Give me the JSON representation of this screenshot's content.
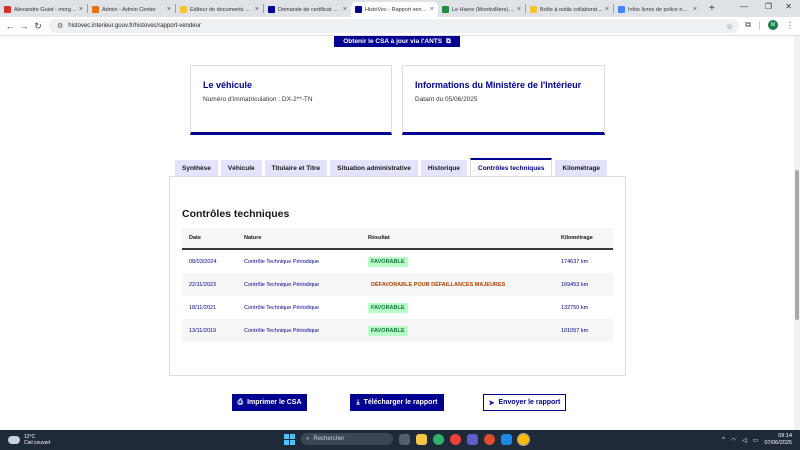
{
  "browser": {
    "tabs": [
      {
        "title": "Alexandre Guiot - morgu...",
        "favicon_color": "#d93025",
        "active": false
      },
      {
        "title": "Admin - Admin Center",
        "favicon_color": "#e8710a",
        "active": false
      },
      {
        "title": "Éditeur de documents de...",
        "favicon_color": "#f4c430",
        "active": false
      },
      {
        "title": "Demande de certificat de...",
        "favicon_color": "#000091",
        "active": false
      },
      {
        "title": "HistoVec - Rapport vendeur",
        "favicon_color": "#000091",
        "active": true
      },
      {
        "title": "Le Havre (Montivilliers) - ...",
        "favicon_color": "#1e8e3e",
        "active": false
      },
      {
        "title": "Boîte à outils collaborative...",
        "favicon_color": "#f4c430",
        "active": false
      },
      {
        "title": "Infos livres de police num...",
        "favicon_color": "#4285f4",
        "active": false
      }
    ],
    "url": "histovec.interieur.gouv.fr/histovec/rapport-vendeur",
    "profile_initial": "M"
  },
  "page": {
    "csa_top_button": "Obtenir le CSA à jour via l'ANTS",
    "vehicle_card": {
      "title": "Le véhicule",
      "text": "Numéro d'immatriculation : DX-2**-TN"
    },
    "ministry_card": {
      "title": "Informations du Ministère de l'Intérieur",
      "text": "Datant du 05/06/2025"
    },
    "tabs": [
      "Synthèse",
      "Véhicule",
      "Titulaire et Titre",
      "Situation administrative",
      "Historique",
      "Contrôles techniques",
      "Kilométrage"
    ],
    "active_tab": "Contrôles techniques",
    "section_title": "Contrôles techniques",
    "table": {
      "headers": [
        "Date",
        "Nature",
        "Résultat",
        "Kilométrage"
      ],
      "rows": [
        {
          "date": "08/03/2024",
          "nature": "Contrôle Technique Périodique",
          "result": "FAVORABLE",
          "result_status": "ok",
          "km": "174637 km"
        },
        {
          "date": "22/11/2023",
          "nature": "Contrôle Technique Périodique",
          "result": "DÉFAVORABLE POUR DÉFAILLANCES MAJEURES",
          "result_status": "ko",
          "km": "169453 km"
        },
        {
          "date": "18/11/2021",
          "nature": "Contrôle Technique Périodique",
          "result": "FAVORABLE",
          "result_status": "ok",
          "km": "132750 km"
        },
        {
          "date": "13/11/2019",
          "nature": "Contrôle Technique Périodique",
          "result": "FAVORABLE",
          "result_status": "ok",
          "km": "101057 km"
        }
      ]
    },
    "actions": {
      "print": "Imprimer le CSA",
      "download": "Télécharger le rapport",
      "send": "Envoyer le rapport"
    }
  },
  "taskbar": {
    "weather_temp": "12°C",
    "weather_desc": "Ciel couvert",
    "search_placeholder": "Rechercher",
    "time": "09:14",
    "date": "07/06/2025"
  },
  "colors": {
    "brand": "#000091",
    "favorable_bg": "#b8fec9",
    "favorable_text": "#18753c",
    "defavorable_text": "#b34000"
  }
}
